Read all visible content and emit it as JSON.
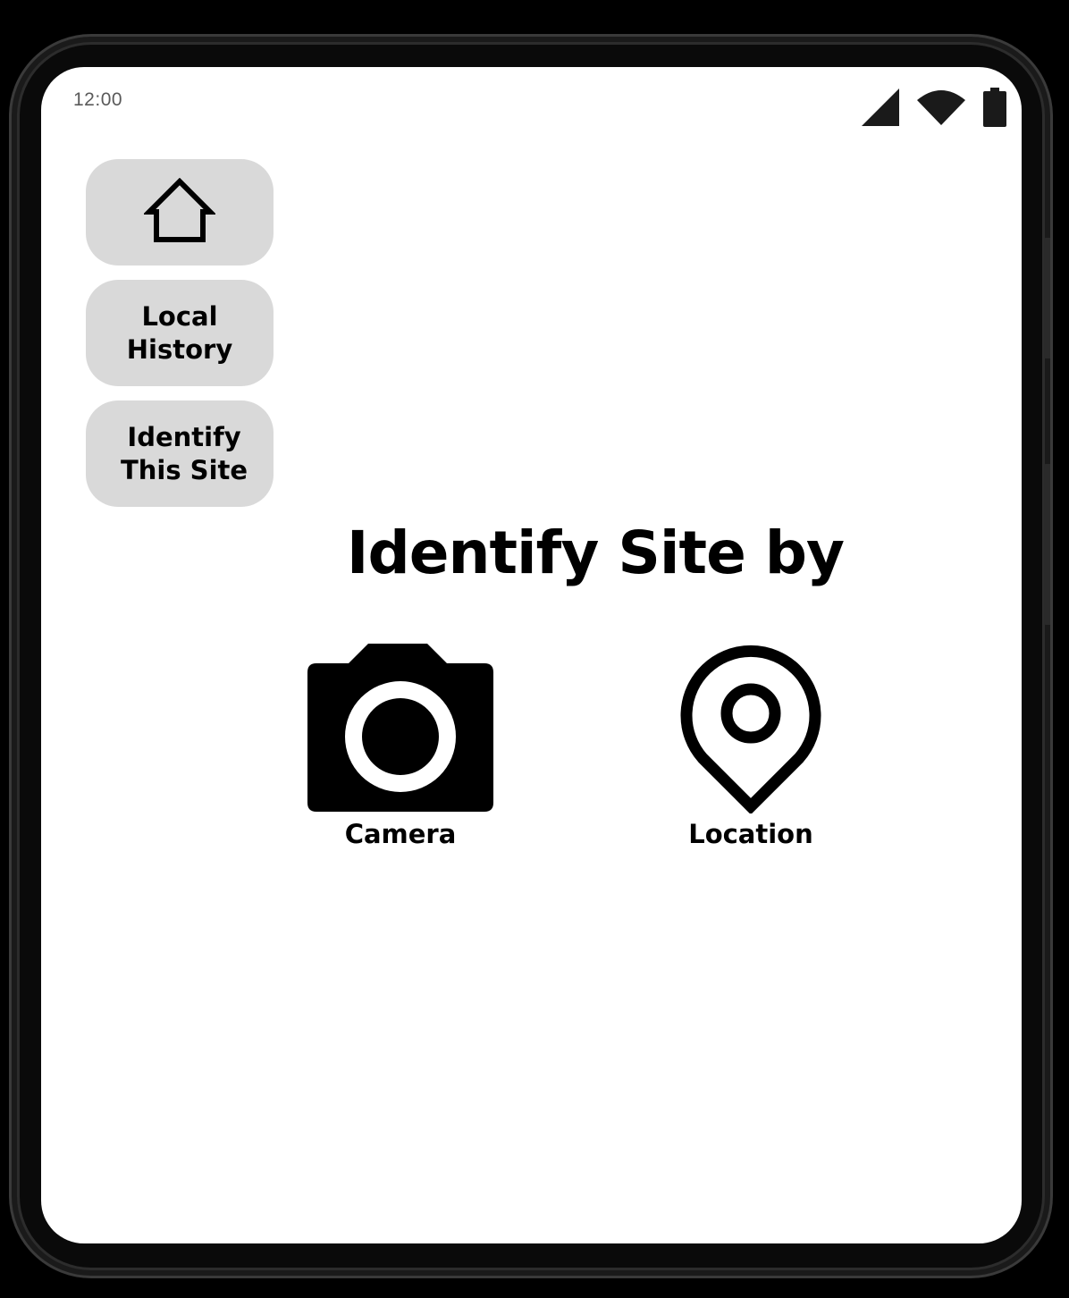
{
  "status_bar": {
    "time": "12:00",
    "icons": [
      "cellular-signal-icon",
      "wifi-icon",
      "battery-icon"
    ]
  },
  "nav": {
    "home_icon": "home-icon",
    "local_history_label": "Local\nHistory",
    "identify_site_label": "Identify\nThis Site"
  },
  "main": {
    "title": "Identify Site by",
    "options": [
      {
        "label": "Camera",
        "icon": "camera-icon"
      },
      {
        "label": "Location",
        "icon": "location-pin-icon"
      }
    ]
  },
  "colors": {
    "nav_button_bg": "#d9d9d9",
    "screen_bg": "#ffffff",
    "text": "#000000",
    "status_text": "#5a5a5a"
  }
}
